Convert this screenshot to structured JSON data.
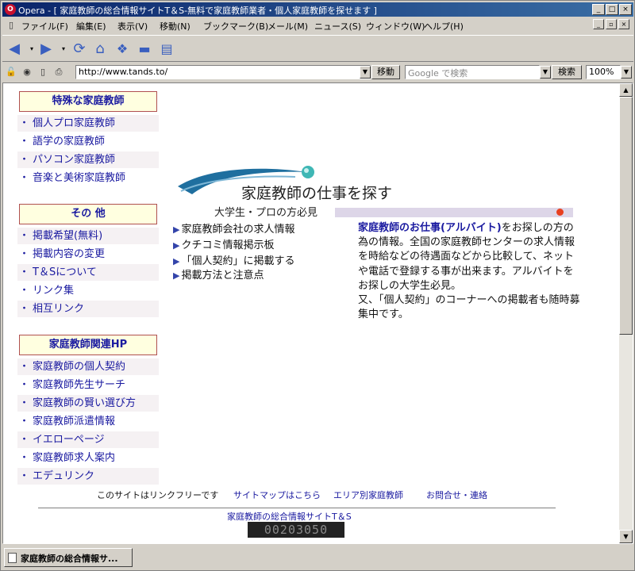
{
  "window": {
    "title": "Opera - [ 家庭教師の総合情報サイトT＆S-無料で家庭教師業者・個人家庭教師を探せます ]",
    "minimize_label": "_",
    "maximize_label": "□",
    "close_label": "×"
  },
  "menu": {
    "items": [
      "ファイル(F)",
      "編集(E)",
      "表示(V)",
      "移動(N)",
      "ブックマーク(B)",
      "メール(M)",
      "ニュース(S)",
      "ウィンドウ(W)",
      "ヘルプ(H)"
    ]
  },
  "address": {
    "url": "http://www.tands.to/",
    "go_label": "移動",
    "search_placeholder": "Google で検索",
    "search_label": "検索",
    "zoom": "100%"
  },
  "sidebar": {
    "sections": [
      {
        "title": "特殊な家庭教師",
        "items": [
          "個人プロ家庭教師",
          "語学の家庭教師",
          "パソコン家庭教師",
          "音楽と美術家庭教師"
        ]
      },
      {
        "title": "その 他",
        "items": [
          "掲載希望(無料)",
          "掲載内容の変更",
          "T＆Sについて",
          "リンク集",
          "相互リンク"
        ]
      },
      {
        "title": "家庭教師関連HP",
        "items": [
          "家庭教師の個人契約",
          "家庭教師先生サーチ",
          "家庭教師の賢い選び方",
          "家庭教師派遣情報",
          "イエローページ",
          "家庭教師求人案内",
          "エデュリンク"
        ]
      }
    ]
  },
  "main": {
    "banner_title": "家庭教師の仕事を探す",
    "banner_sub": "大学生・プロの方必見",
    "links": [
      "家庭教師会社の求人情報",
      "クチコミ情報掲示板",
      "「個人契約」に掲載する",
      "掲載方法と注意点"
    ],
    "desc_highlight": "家庭教師のお仕事(アルバイト)",
    "desc_text": "をお探しの方の為の情報。全国の家庭教師センターの求人情報を時給などの待遇面などから比較して、ネットや電話で登録する事が出来ます。アルバイトをお探しの大学生必見。",
    "desc_text2": "又、「個人契約」のコーナーへの掲載者も随時募集中です。"
  },
  "footer": {
    "static": "このサイトはリンクフリーです",
    "links": [
      "サイトマップはこちら",
      "エリア別家庭教師",
      "お問合せ・連絡"
    ],
    "site_title": "家庭教師の総合情報サイトT＆S",
    "counter": "00203050"
  },
  "status": {
    "tab_label": "家庭教師の総合情報サ..."
  }
}
